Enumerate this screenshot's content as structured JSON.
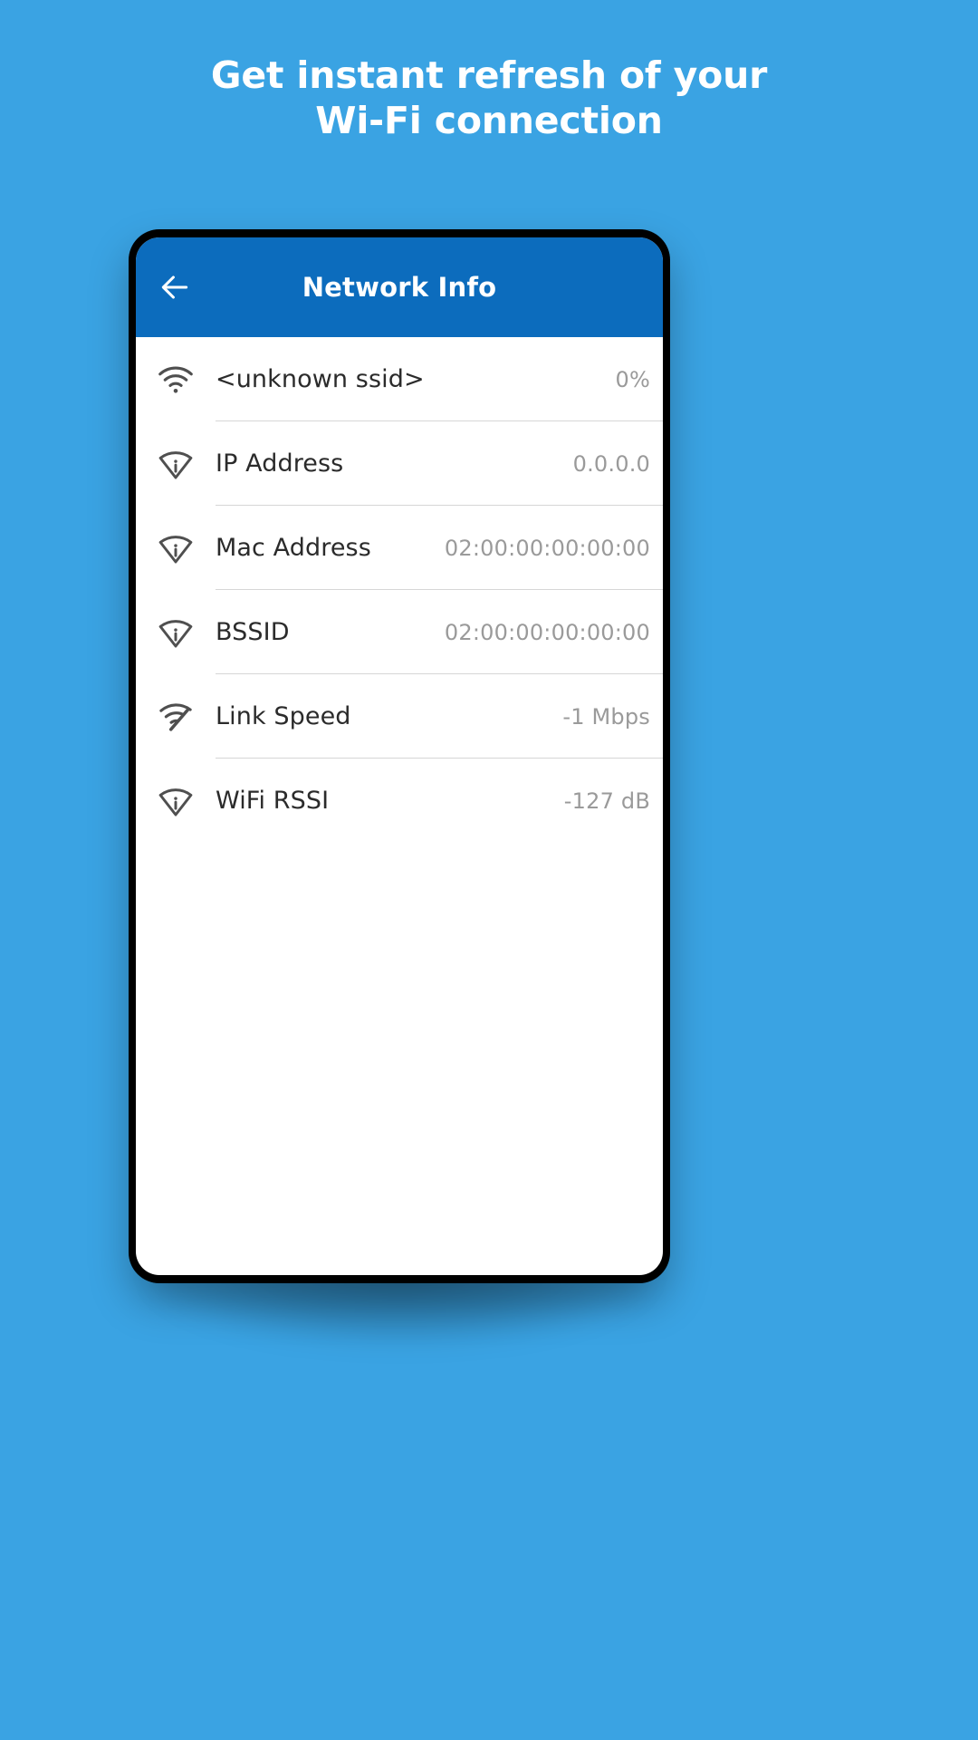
{
  "page": {
    "background_color": "#3aa3e3",
    "headline_line1": "Get instant refresh of your",
    "headline_line2": "Wi-Fi connection"
  },
  "phone": {
    "appbar": {
      "title": "Network Info",
      "back_icon": "arrow-left-icon",
      "background_color": "#0c6cbd",
      "title_color": "#ffffff"
    },
    "list": {
      "label_color": "#2b2b2b",
      "value_color": "#9a9a9a",
      "divider_color": "#d6d6d6",
      "rows": [
        {
          "icon": "wifi-signal-icon",
          "label": "<unknown ssid>",
          "value": "0%"
        },
        {
          "icon": "wifi-info-icon",
          "label": "IP Address",
          "value": "0.0.0.0"
        },
        {
          "icon": "wifi-info-icon",
          "label": "Mac Address",
          "value": "02:00:00:00:00:00"
        },
        {
          "icon": "wifi-info-icon",
          "label": "BSSID",
          "value": "02:00:00:00:00:00"
        },
        {
          "icon": "wifi-speed-icon",
          "label": "Link Speed",
          "value": "-1 Mbps"
        },
        {
          "icon": "wifi-info-icon",
          "label": "WiFi RSSI",
          "value": "-127 dB"
        }
      ]
    }
  }
}
